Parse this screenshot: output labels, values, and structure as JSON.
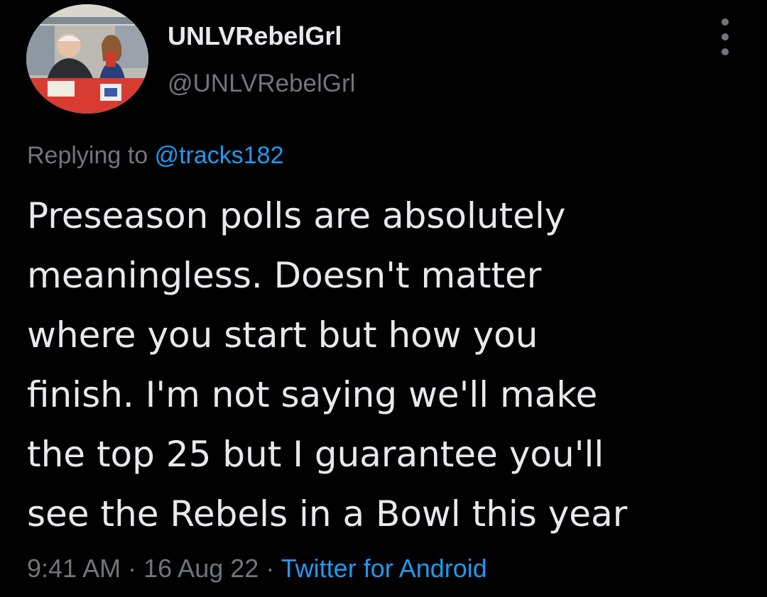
{
  "author": {
    "display_name": "UNLVRebelGrl",
    "handle": "@UNLVRebelGrl",
    "avatar_icon": "profile-photo"
  },
  "menu": {
    "icon": "more-vertical-icon"
  },
  "reply": {
    "prefix": "Replying to",
    "mention": "@tracks182"
  },
  "tweet": {
    "lines": [
      "Preseason polls are absolutely",
      "meaningless. Doesn't matter",
      "where you start but how you",
      "finish. I'm not saying we'll make",
      "the top 25 but I guarantee you'll",
      "see the Rebels in a Bowl this year"
    ]
  },
  "meta": {
    "time": "9:41 AM",
    "separator": "·",
    "date": "16 Aug 22",
    "source": "Twitter for Android"
  },
  "colors": {
    "background": "#000000",
    "text": "#e7e9ea",
    "muted": "#71767b",
    "accent": "#1d9bf0"
  }
}
